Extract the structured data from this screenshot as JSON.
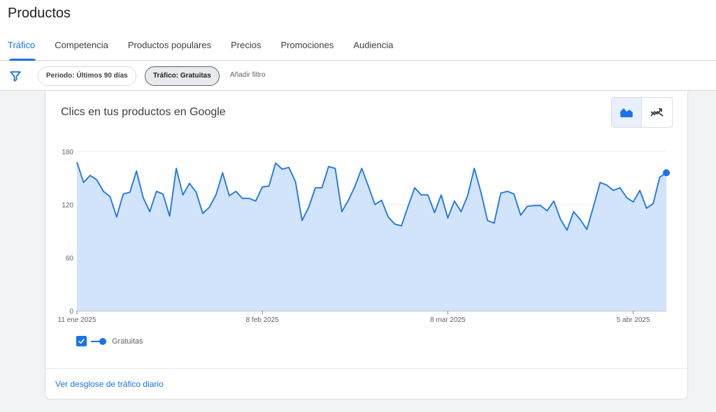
{
  "header": {
    "title": "Productos"
  },
  "tabs": [
    {
      "label": "Tráfico",
      "active": true
    },
    {
      "label": "Competencia"
    },
    {
      "label": "Productos populares"
    },
    {
      "label": "Precios"
    },
    {
      "label": "Promociones"
    },
    {
      "label": "Audiencia"
    }
  ],
  "filters": {
    "period_label": "Periodo: Últimos 90 días",
    "traffic_label": "Tráfico: Gratuitas",
    "add_filter_label": "Añadir filtro"
  },
  "card": {
    "title": "Clics en tus productos en Google",
    "link_label": "Ver desglose de tráfico diario",
    "view_toggle": {
      "selected": "area-chart-icon",
      "other": "trending-icon"
    }
  },
  "colors": {
    "accent": "#1a73e8",
    "area_fill": "#d2e3fc",
    "grid": "#e8eaed"
  },
  "chart_data": {
    "type": "area",
    "x_ticks": [
      {
        "label": "11 ene 2025",
        "index": 0
      },
      {
        "label": "8 feb 2025",
        "index": 28
      },
      {
        "label": "8 mar 2025",
        "index": 56
      },
      {
        "label": "5 abr 2025",
        "index": 84
      }
    ],
    "y_ticks": [
      0,
      60,
      120,
      180
    ],
    "ylim": [
      0,
      180
    ],
    "grid": true,
    "series": [
      {
        "name": "Gratuitas",
        "values": [
          168,
          145,
          153,
          148,
          135,
          129,
          106,
          132,
          134,
          158,
          128,
          112,
          135,
          132,
          107,
          161,
          131,
          144,
          134,
          110,
          117,
          131,
          156,
          130,
          135,
          127,
          127,
          124,
          140,
          141,
          167,
          160,
          162,
          146,
          102,
          117,
          139,
          139,
          163,
          161,
          112,
          125,
          141,
          161,
          141,
          120,
          125,
          106,
          98,
          96,
          118,
          139,
          131,
          131,
          111,
          131,
          105,
          124,
          112,
          130,
          161,
          134,
          102,
          99,
          133,
          135,
          132,
          108,
          118,
          119,
          119,
          113,
          124,
          104,
          91,
          112,
          103,
          92,
          118,
          145,
          142,
          136,
          139,
          128,
          123,
          136,
          116,
          121,
          151,
          156
        ]
      }
    ]
  },
  "legend": {
    "label": "Gratuitas"
  }
}
